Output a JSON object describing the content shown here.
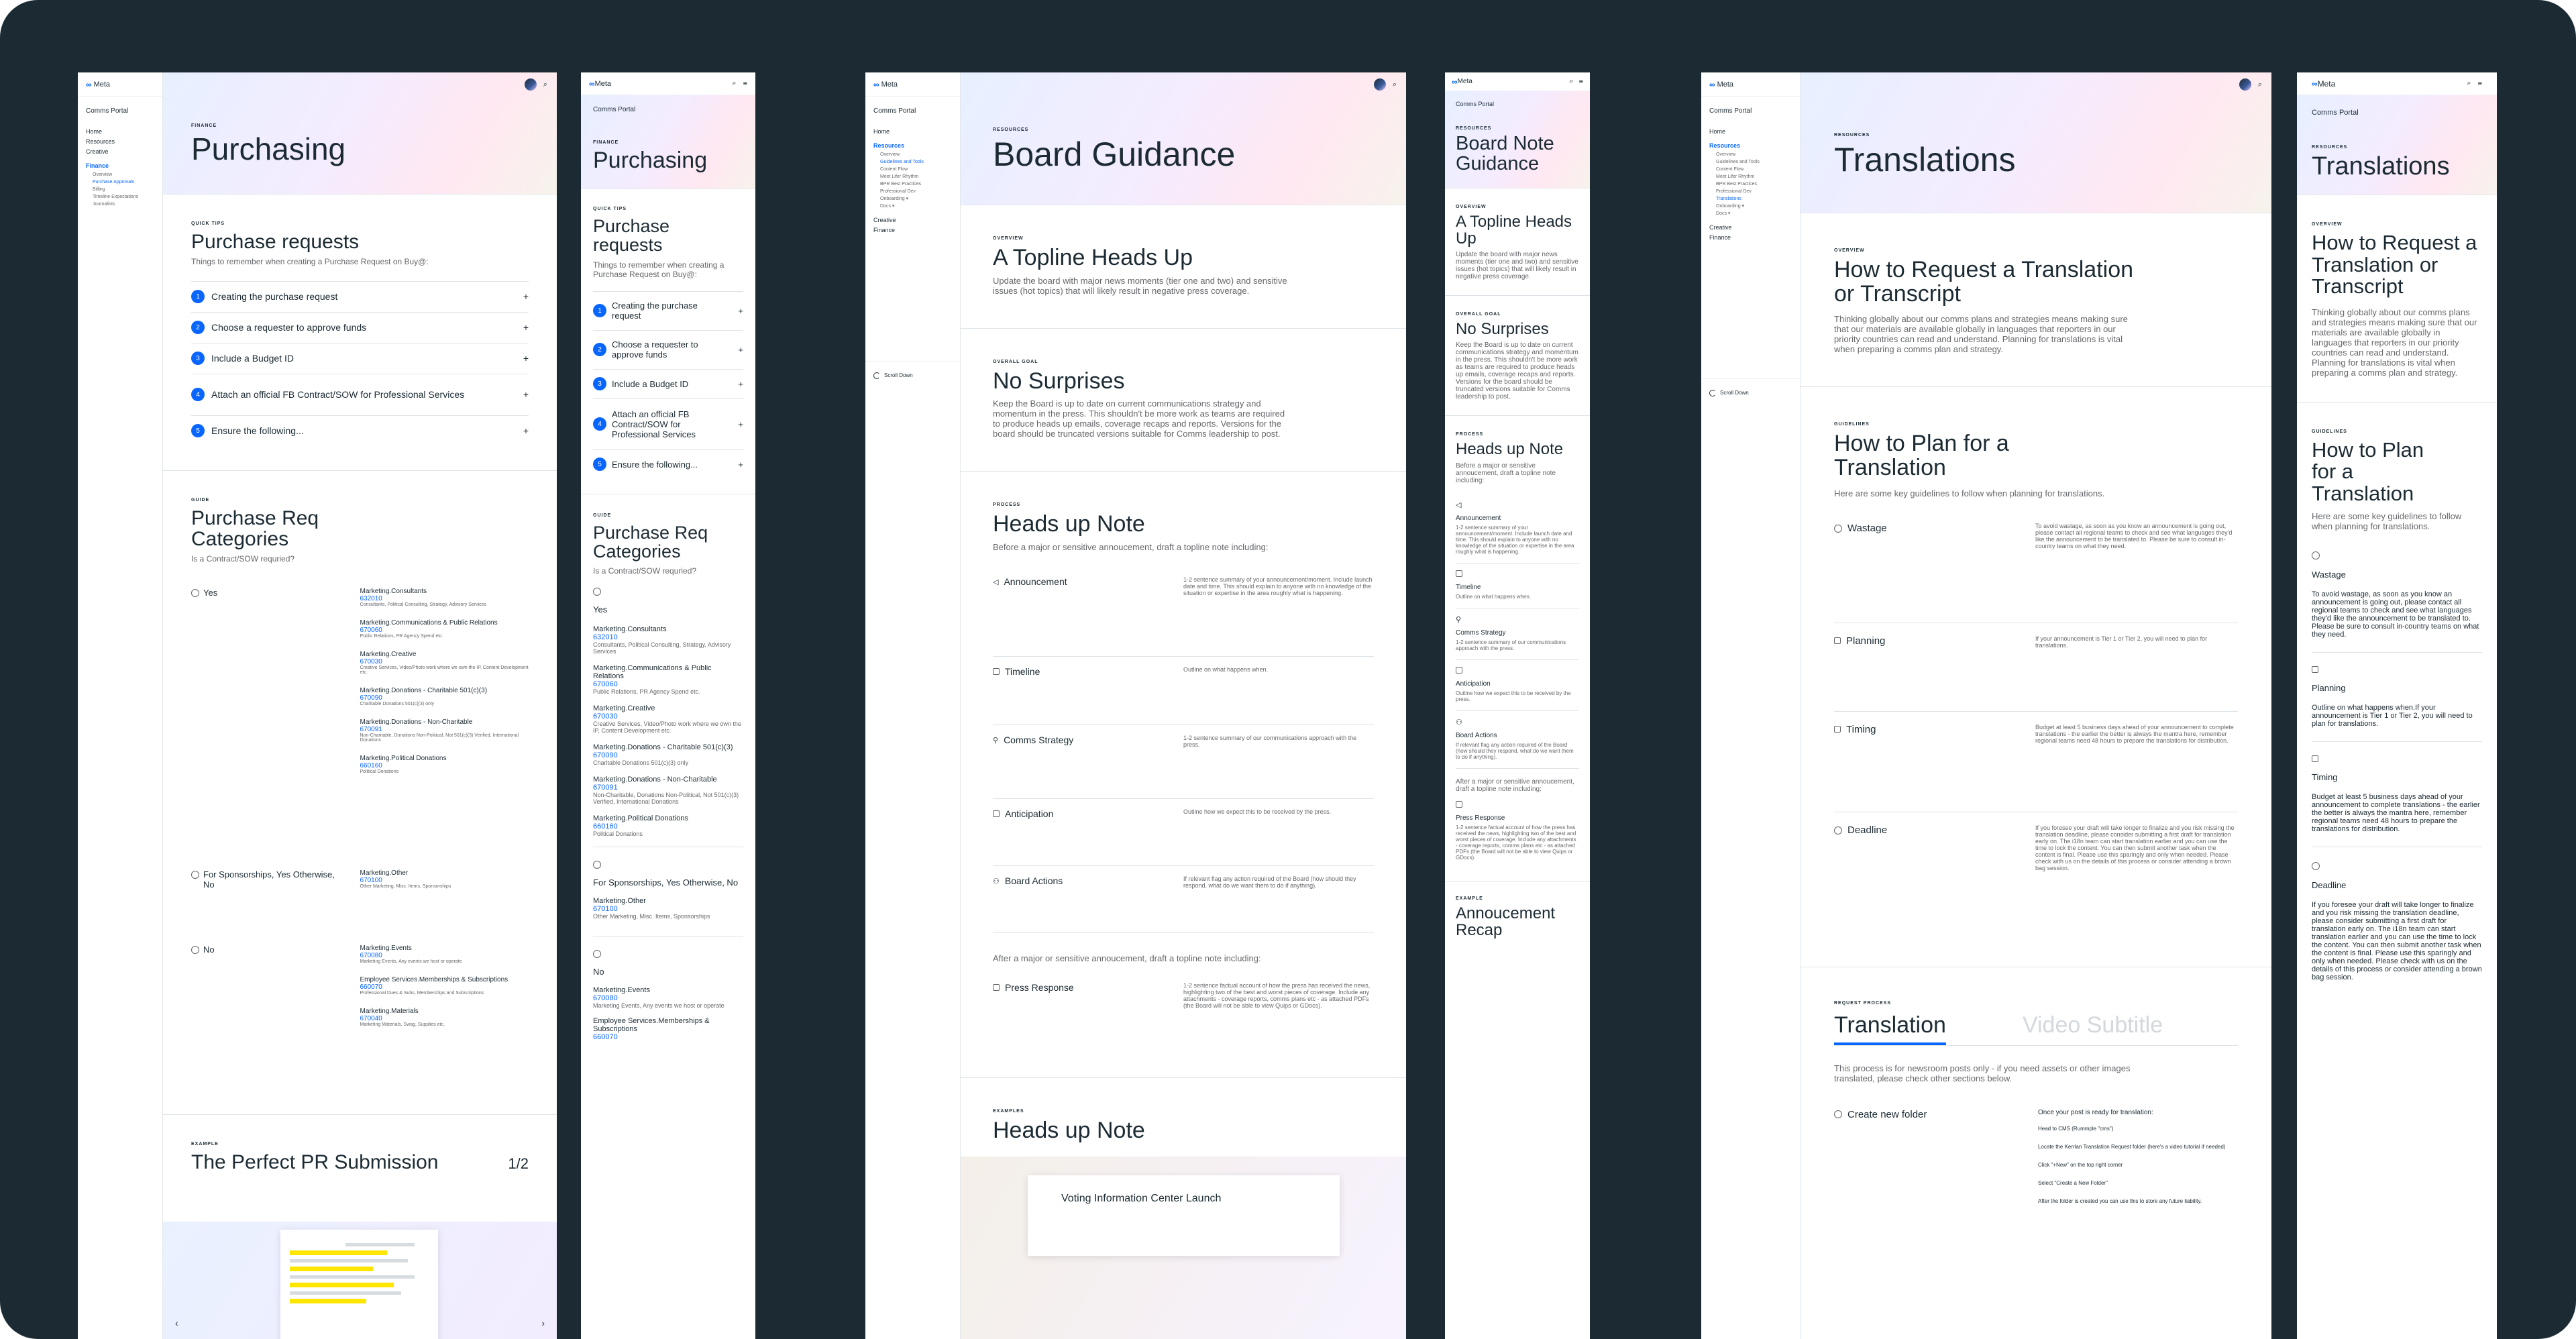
{
  "common": {
    "brand": "Meta",
    "portal": "Comms Portal",
    "scroll_down": "Scroll Down",
    "nav_home": "Home",
    "nav_resources": "Resources",
    "nav_creative": "Creative",
    "nav_finance": "Finance"
  },
  "purchasing": {
    "eyebrow": "FINANCE",
    "title": "Purchasing",
    "nav_sub": [
      "Overview",
      "Purchase Approvals",
      "Billing",
      "Timeline Expectations",
      "Journalists"
    ],
    "quicktips": {
      "eyebrow": "QUICK TIPS",
      "title": "Purchase requests",
      "desc": "Things to remember when creating a Purchase Request on Buy@:",
      "items": [
        {
          "num": "1",
          "label": "Creating the purchase request"
        },
        {
          "num": "2",
          "label": "Choose a requester to approve funds"
        },
        {
          "num": "3",
          "label": "Include a Budget ID"
        },
        {
          "num": "4",
          "label": "Attach an official FB Contract/SOW for Professional Services"
        },
        {
          "num": "5",
          "label": "Ensure the following..."
        }
      ]
    },
    "guide": {
      "eyebrow": "GUIDE",
      "title": "Purchase Req Categories",
      "question": "Is a Contract/SOW requried?",
      "groups": [
        {
          "label": "Yes",
          "entries": [
            {
              "name": "Marketing.Consultants",
              "code": "632010",
              "desc": "Consultants, Political Consulting, Strategy, Advisory Services"
            },
            {
              "name": "Marketing.Communications & Public Relations",
              "code": "670060",
              "desc": "Public Relations, PR Agency Spend etc."
            },
            {
              "name": "Marketing.Creative",
              "code": "670030",
              "desc": "Creative Services, Video/Photo work where we own the IP, Content Development etc."
            },
            {
              "name": "Marketing.Donations - Charitable 501(c)(3)",
              "code": "670090",
              "desc": "Charitable Donations 501(c)(3) only"
            },
            {
              "name": "Marketing.Donations - Non-Charitable",
              "code": "670091",
              "desc": "Non-Charitable, Donations Non-Political, Not 501(c)(3) Verified, International Donations"
            },
            {
              "name": "Marketing.Political Donations",
              "code": "660160",
              "desc": "Political Donations"
            }
          ]
        },
        {
          "label": "For Sponsorships, Yes Otherwise, No",
          "entries": [
            {
              "name": "Marketing.Other",
              "code": "670100",
              "desc": "Other Marketing, Misc. Items, Sponsorships"
            }
          ]
        },
        {
          "label": "No",
          "entries": [
            {
              "name": "Marketing.Events",
              "code": "670080",
              "desc": "Marketing Events, Any events we host or operate"
            },
            {
              "name": "Employee Services.Memberships & Subscriptions",
              "code": "660070",
              "desc": "Professional Dues & Subs, Memberships and Subscriptions"
            },
            {
              "name": "Marketing.Materials",
              "code": "670040",
              "desc": "Marketing Materials, Swag, Supplies etc."
            }
          ]
        }
      ]
    },
    "example": {
      "eyebrow": "EXAMPLE",
      "title": "The Perfect PR Submission",
      "pager": "1/2"
    }
  },
  "board": {
    "eyebrow": "RESOURCES",
    "title": "Board Guidance",
    "mobile_title": "Board Note Guidance",
    "nav_sub": [
      "Overview",
      "Guidelines and Tools",
      "Content Flow",
      "Meet Lifer Rhythm",
      "BPR Best Practices",
      "Professional Dev",
      "Onboarding ▾",
      "Docs ▾"
    ],
    "overview": {
      "eyebrow": "OVERVIEW",
      "title": "A Topline Heads Up",
      "desc": "Update the board with major news moments (tier one and two) and sensitive issues (hot topics) that will likely result in negative press coverage."
    },
    "goal": {
      "eyebrow": "OVERALL GOAL",
      "title": "No Surprises",
      "desc": "Keep the Board is up to date on current communications strategy and momentum in the press. This shouldn't be more work as teams are required to produce heads up emails, coverage recaps and reports. Versions for the board should be truncated versions suitable for Comms leadership to post."
    },
    "process": {
      "eyebrow": "PROCESS",
      "title": "Heads up Note",
      "desc": "Before a major or sensitive annoucement, draft a topline note including:",
      "rows": [
        {
          "label": "Announcement",
          "text": "1-2 sentence summary of your announcement/moment. Include launch date and time. This should explain to anyone with no knowledge of the situation or expertise in the area roughly what is happening."
        },
        {
          "label": "Timeline",
          "text": "Outline on what happens when."
        },
        {
          "label": "Comms Strategy",
          "text": "1-2 sentence summary of our communications approach with the press."
        },
        {
          "label": "Anticipation",
          "text": "Outline how we expect this to be received by the press."
        },
        {
          "label": "Board Actions",
          "text": "If relevant flag any action required of the Board (how should they respond, what do we want them to do if anything)."
        }
      ],
      "after": "After a major or sensitive annoucement, draft a topline note including:",
      "press": {
        "label": "Press Response",
        "text": "1-2 sentence factual account of how the press has received the news, highlighting two of the best and worst pieces of coverage. Include any attachments - coverage reports, comms plans etc - as attached PDFs (the Board will not be able to view Quips or GDocs)."
      }
    },
    "examples": {
      "eyebrow": "EXAMPLES",
      "title": "Heads up Note",
      "card_title": "Voting Information Center Launch"
    },
    "mobile_example": {
      "eyebrow": "EXAMPLE",
      "title": "Annoucement Recap"
    }
  },
  "translations": {
    "eyebrow": "RESOURCES",
    "title": "Translations",
    "nav_sub": [
      "Overview",
      "Guidelines and Tools",
      "Content Flow",
      "Meet Lifer Rhythm",
      "BPR Best Practices",
      "Professional Dev",
      "Translations",
      "Onboarding ▾",
      "Docs ▾"
    ],
    "overview": {
      "eyebrow": "OVERVIEW",
      "title": "How to Request a Translation or Transcript",
      "desc": "Thinking globally about our comms plans and strategies means making sure that our materials are available globally in languages that reporters in our priority countries can read and understand. Planning for translations is vital when preparing a comms plan and strategy."
    },
    "guidelines": {
      "eyebrow": "GUIDELINES",
      "title": "How to Plan for a Translation",
      "desc": "Here are some key guidelines to follow when planning for translations.",
      "rows": [
        {
          "label": "Wastage",
          "text": "To avoid wastage, as soon as you know an announcement is going out, please contact all regional teams to check and see what languages they'd like the announcement to be translated to. Please be sure to consult in-country teams on what they need."
        },
        {
          "label": "Planning",
          "text": "If your announcement is Tier 1 or Tier 2, you will need to plan for translations."
        },
        {
          "label": "Timing",
          "text": "Budget at least 5 business days ahead of your announcement to complete translations - the earlier the better is always the mantra here, remember regional teams need 48 hours to prepare the translations for distribution."
        },
        {
          "label": "Deadline",
          "text": "If you foresee your draft will take longer to finalize and you risk missing the translation deadline, please consider submitting a first draft for translation early on. The i18n team can start translation earlier and you can use the time to lock the content. You can then submit another task when the content is final. Please use this sparingly and only when needed. Please check with us on the details of this process or consider attending a brown bag session."
        }
      ],
      "mobile_planning": "Outline on what happens when.If your announcement is Tier 1 or Tier 2, you will need to plan for translations."
    },
    "request": {
      "eyebrow": "REQUEST PROCESS",
      "tab_active": "Translation",
      "tab_inactive": "Video Subtitle",
      "desc": "This process is for newsroom posts only - if you need assets or other images translated, please check other sections below.",
      "step": "Create new folder",
      "ready": "Once your post is ready for translation:",
      "bullets": [
        "Head to CMS (Rummple \"cms\")",
        "Locate the Kerrlan Translation Request folder (here's a video tutorial if needed)",
        "Click \"+New\" on the top right corner",
        "Select \"Create a New Folder\"",
        "After the folder is created you can use this to store any future liability."
      ]
    }
  },
  "colors": {
    "accent": "#0866ff",
    "frame": "#1c2b33",
    "ink": "#1c2b33",
    "muted": "#65676b"
  }
}
